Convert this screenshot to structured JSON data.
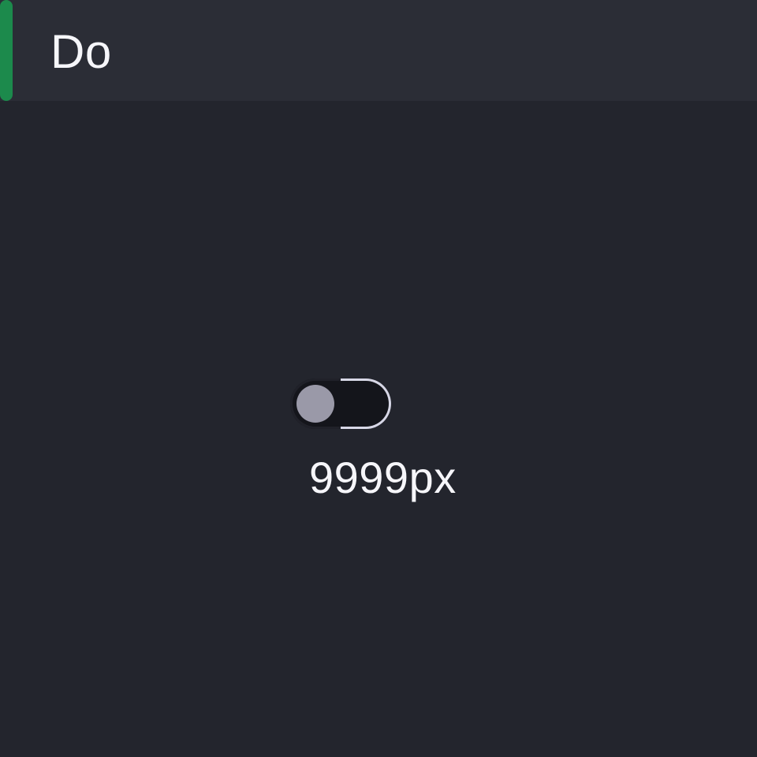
{
  "header": {
    "title": "Do",
    "accent_color": "#1c8a4c"
  },
  "toggle": {
    "state": "off",
    "value_label": "9999px"
  },
  "colors": {
    "background": "#23252d",
    "header_background": "#2b2d36",
    "toggle_track": "#14151b",
    "toggle_knob": "#9a99a8",
    "toggle_outline": "#d7d7e6"
  }
}
